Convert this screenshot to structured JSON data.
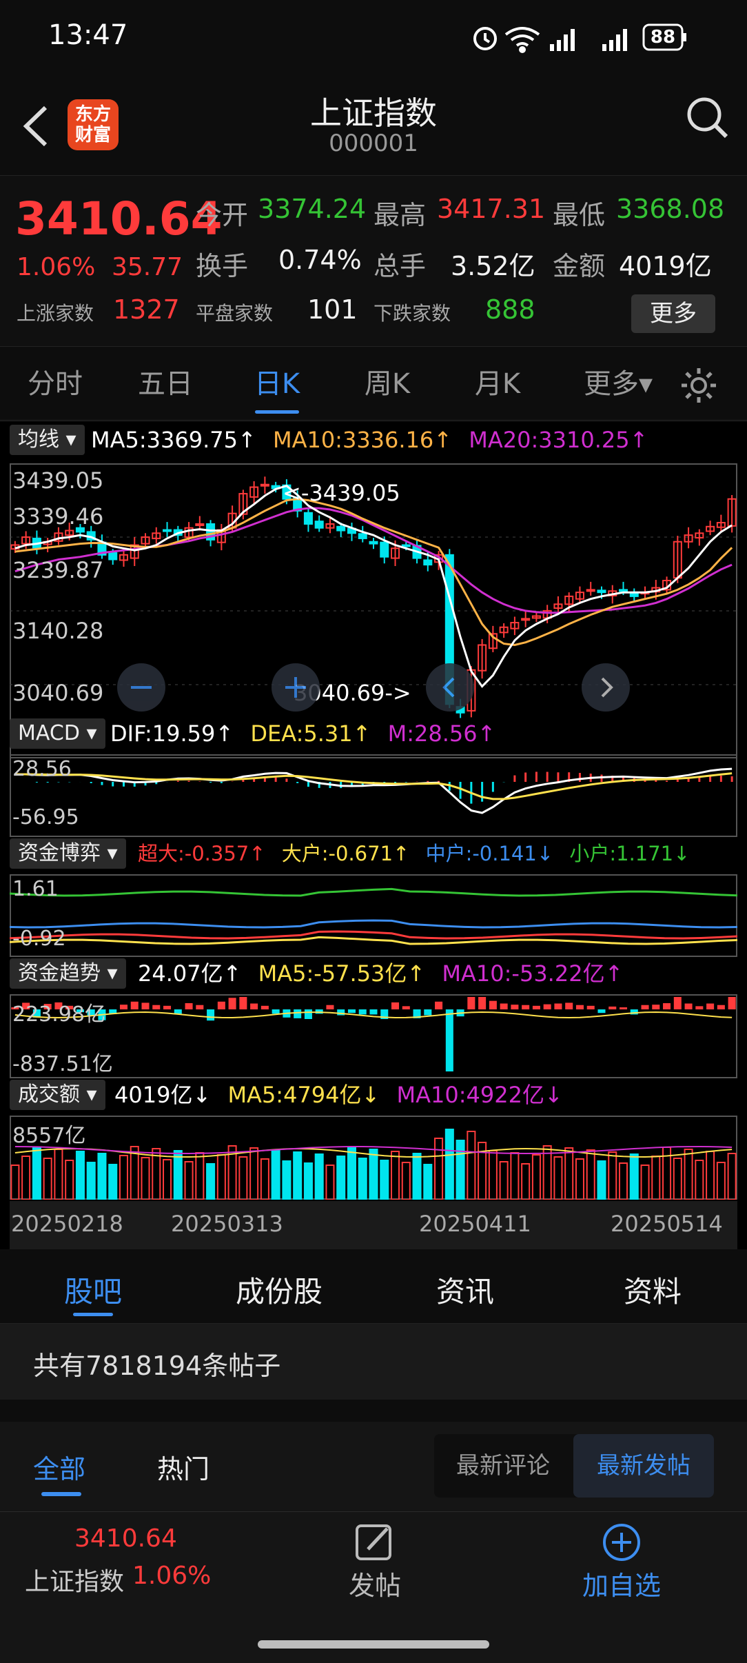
{
  "status": {
    "time": "13:47",
    "battery": "88"
  },
  "nav": {
    "title": "上证指数",
    "code": "000001",
    "logo_line1": "东方",
    "logo_line2": "财富"
  },
  "quote": {
    "price": "3410.64",
    "change_pct": "1.06%",
    "change": "35.77",
    "open_label": "今开",
    "open": "3374.24",
    "high_label": "最高",
    "high": "3417.31",
    "low_label": "最低",
    "low": "3368.08",
    "turnover_label": "换手",
    "turnover": "0.74%",
    "volume_label": "总手",
    "volume": "3.52亿",
    "amount_label": "金额",
    "amount": "4019亿",
    "up_label": "上涨家数",
    "up": "1327",
    "flat_label": "平盘家数",
    "flat": "101",
    "down_label": "下跌家数",
    "down": "888",
    "more_label": "更多"
  },
  "tabs": {
    "items": [
      "分时",
      "五日",
      "日K",
      "周K",
      "月K",
      "更多▾"
    ],
    "active": "日K"
  },
  "kline": {
    "indicator": "均线",
    "ma5": "MA5:3369.75↑",
    "ma10": "MA10:3336.16↑",
    "ma20": "MA20:3310.25↑",
    "yticks": [
      "3439.05",
      "3339.46",
      "3239.87",
      "3140.28",
      "3040.69"
    ],
    "high_marker": "<-3439.05",
    "low_marker": "3040.69->"
  },
  "macd": {
    "label": "MACD",
    "dif": "DIF:19.59↑",
    "dea": "DEA:5.31↑",
    "m": "M:28.56↑",
    "yticks": [
      "28.56",
      "-56.95"
    ]
  },
  "fund_game": {
    "label": "资金博弈",
    "super": "超大:-0.357↑",
    "large": "大户:-0.671↑",
    "mid": "中户:-0.141↓",
    "small": "小户:1.171↓",
    "yticks": [
      "1.61",
      "-0.92"
    ]
  },
  "fund_trend": {
    "label": "资金趋势",
    "val": "24.07亿↑",
    "ma5": "MA5:-57.53亿↑",
    "ma10": "MA10:-53.22亿↑",
    "yticks": [
      "223.98亿",
      "-837.51亿"
    ]
  },
  "volume": {
    "label": "成交额",
    "val": "4019亿↓",
    "ma5": "MA5:4794亿↓",
    "ma10": "MA10:4922亿↓",
    "ytick": "8557亿"
  },
  "dates": [
    "20250218",
    "20250313",
    "20250411",
    "20250514"
  ],
  "bottom_tabs": {
    "items": [
      "股吧",
      "成份股",
      "资讯",
      "资料"
    ],
    "active": "股吧"
  },
  "posts": {
    "count_text": "共有7818194条帖子"
  },
  "filter": {
    "all": "全部",
    "hot": "热门",
    "latest_comment": "最新评论",
    "latest_post": "最新发帖"
  },
  "footer": {
    "price": "3410.64",
    "name": "上证指数",
    "pct": "1.06%",
    "post": "发帖",
    "add": "加自选"
  },
  "colors": {
    "up": "#ff3b3b",
    "down": "#00e5ee",
    "accent": "#3d8ef0",
    "ma5": "#ffffff",
    "ma10": "#ffb347",
    "ma20": "#d02fd0"
  },
  "chart_data": {
    "type": "candlestick",
    "title": "上证指数 日K",
    "ylim": [
      3040.69,
      3439.05
    ],
    "closes": [
      3340,
      3352,
      3336,
      3345,
      3358,
      3362,
      3360,
      3348,
      3325,
      3318,
      3325,
      3340,
      3352,
      3358,
      3362,
      3355,
      3366,
      3372,
      3348,
      3363,
      3388,
      3418,
      3428,
      3432,
      3426,
      3410,
      3392,
      3372,
      3366,
      3372,
      3362,
      3358,
      3350,
      3342,
      3322,
      3335,
      3338,
      3320,
      3310,
      3325,
      3098,
      3085,
      3150,
      3188,
      3205,
      3215,
      3222,
      3228,
      3232,
      3240,
      3250,
      3262,
      3268,
      3272,
      3268,
      3270,
      3270,
      3262,
      3268,
      3275,
      3286,
      3345,
      3355,
      3358,
      3368,
      3374,
      3410
    ],
    "ma5": [
      3335,
      3340,
      3342,
      3345,
      3350,
      3352,
      3355,
      3352,
      3345,
      3338,
      3335,
      3332,
      3335,
      3340,
      3350,
      3358,
      3362,
      3364,
      3362,
      3362,
      3372,
      3390,
      3402,
      3415,
      3425,
      3430,
      3416,
      3400,
      3390,
      3382,
      3372,
      3366,
      3360,
      3355,
      3347,
      3340,
      3335,
      3330,
      3325,
      3318,
      3260,
      3200,
      3148,
      3125,
      3142,
      3170,
      3195,
      3210,
      3220,
      3228,
      3235,
      3245,
      3252,
      3258,
      3262,
      3265,
      3268,
      3268,
      3268,
      3270,
      3275,
      3290,
      3305,
      3325,
      3345,
      3360,
      3370
    ],
    "ma10": [
      3330,
      3332,
      3334,
      3336,
      3338,
      3340,
      3342,
      3343,
      3343,
      3342,
      3340,
      3338,
      3337,
      3337,
      3340,
      3345,
      3350,
      3354,
      3357,
      3360,
      3366,
      3374,
      3383,
      3392,
      3400,
      3408,
      3410,
      3408,
      3404,
      3400,
      3395,
      3388,
      3380,
      3373,
      3366,
      3360,
      3354,
      3348,
      3342,
      3336,
      3310,
      3280,
      3250,
      3220,
      3200,
      3190,
      3188,
      3192,
      3198,
      3205,
      3212,
      3220,
      3227,
      3234,
      3240,
      3246,
      3250,
      3254,
      3258,
      3262,
      3266,
      3272,
      3280,
      3290,
      3302,
      3320,
      3336
    ],
    "ma20": [
      3300,
      3305,
      3310,
      3314,
      3318,
      3320,
      3322,
      3325,
      3328,
      3330,
      3332,
      3334,
      3336,
      3338,
      3340,
      3343,
      3346,
      3350,
      3353,
      3356,
      3360,
      3366,
      3372,
      3378,
      3384,
      3390,
      3394,
      3396,
      3396,
      3394,
      3390,
      3385,
      3378,
      3370,
      3362,
      3354,
      3346,
      3338,
      3330,
      3322,
      3308,
      3294,
      3280,
      3268,
      3258,
      3250,
      3244,
      3240,
      3238,
      3237,
      3237,
      3238,
      3239,
      3240,
      3241,
      3242,
      3244,
      3246,
      3248,
      3252,
      3258,
      3266,
      3274,
      3284,
      3294,
      3303,
      3310
    ]
  }
}
